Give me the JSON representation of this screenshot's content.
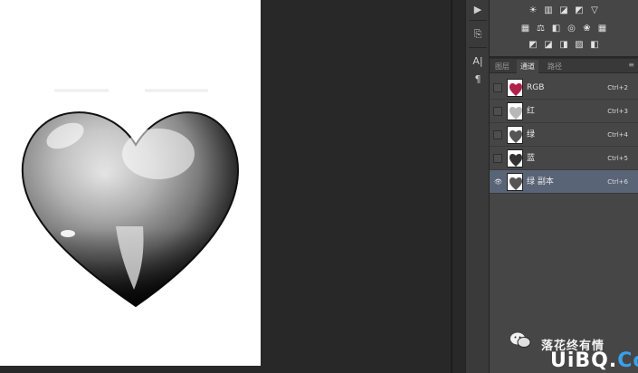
{
  "tool_strip": {
    "items": [
      {
        "name": "play-icon",
        "glyph": "▶"
      },
      {
        "name": "clone-source-icon",
        "glyph": "⎘"
      },
      {
        "name": "character-icon",
        "glyph": "A|"
      },
      {
        "name": "paragraph-icon",
        "glyph": "¶"
      }
    ]
  },
  "adjustments": {
    "row1": [
      "☀",
      "▥",
      "◪",
      "◩",
      "▽"
    ],
    "row2": [
      "▦",
      "⚖",
      "◧",
      "◎",
      "❀",
      "▦"
    ],
    "row3": [
      "◩",
      "◪",
      "◨",
      "▨",
      "◧"
    ]
  },
  "panel": {
    "tabs": [
      "图层",
      "通道",
      "路径"
    ],
    "active_tab": 1,
    "menu_glyph": "≡"
  },
  "channels": [
    {
      "name": "RGB",
      "shortcut": "Ctrl+2",
      "visible": false,
      "selected": false,
      "thumb": "rgb"
    },
    {
      "name": "红",
      "shortcut": "Ctrl+3",
      "visible": false,
      "selected": false,
      "thumb": "light"
    },
    {
      "name": "绿",
      "shortcut": "Ctrl+4",
      "visible": false,
      "selected": false,
      "thumb": "mid"
    },
    {
      "name": "蓝",
      "shortcut": "Ctrl+5",
      "visible": false,
      "selected": false,
      "thumb": "dark"
    },
    {
      "name": "绿 副本",
      "shortcut": "Ctrl+6",
      "visible": true,
      "selected": true,
      "thumb": "mid"
    }
  ],
  "watermark": {
    "text": "落花终有情",
    "logo_part1": "UiBQ.",
    "logo_part2": "CoM"
  },
  "colors": {
    "selection": "#5a6477",
    "panel_bg": "#464646",
    "logo_blue": "#3aa0ea"
  }
}
